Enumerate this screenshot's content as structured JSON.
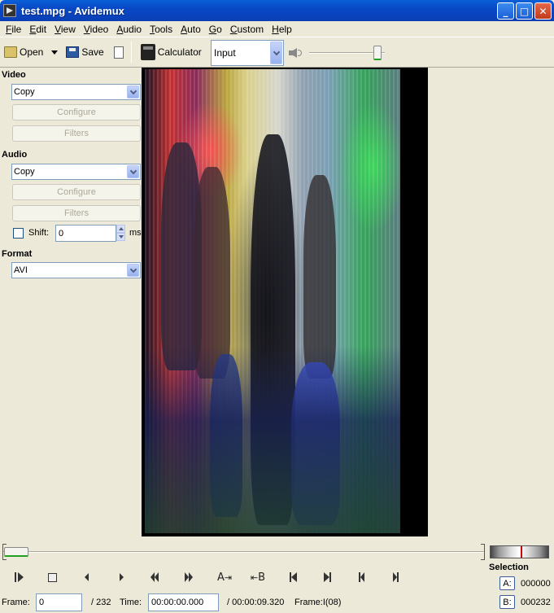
{
  "window": {
    "title": "test.mpg - Avidemux"
  },
  "menu": [
    "File",
    "Edit",
    "View",
    "Video",
    "Audio",
    "Tools",
    "Auto",
    "Go",
    "Custom",
    "Help"
  ],
  "toolbar": {
    "open_label": "Open",
    "save_label": "Save",
    "calculator_label": "Calculator",
    "input_select": "Input",
    "volume_level": 0.95
  },
  "left_panel": {
    "video_heading": "Video",
    "video_codec": "Copy",
    "video_configure": "Configure",
    "video_filters": "Filters",
    "audio_heading": "Audio",
    "audio_codec": "Copy",
    "audio_configure": "Configure",
    "audio_filters": "Filters",
    "shift_label": "Shift:",
    "shift_value": "0",
    "shift_unit": "ms",
    "format_heading": "Format",
    "format_value": "AVI"
  },
  "timeline": {
    "position_fraction": 0.0
  },
  "transport": {
    "mark_a_label": "A",
    "mark_b_label": "B"
  },
  "selection": {
    "heading": "Selection",
    "a_label": "A:",
    "a_value": "000000",
    "b_label": "B:",
    "b_value": "000232"
  },
  "status": {
    "frame_label": "Frame:",
    "frame_value": "0",
    "frame_total": "/ 232",
    "time_label": "Time:",
    "time_value": "00:00:00.000",
    "time_total": "/ 00:00:09.320",
    "frame_type": "Frame:I(08)"
  }
}
